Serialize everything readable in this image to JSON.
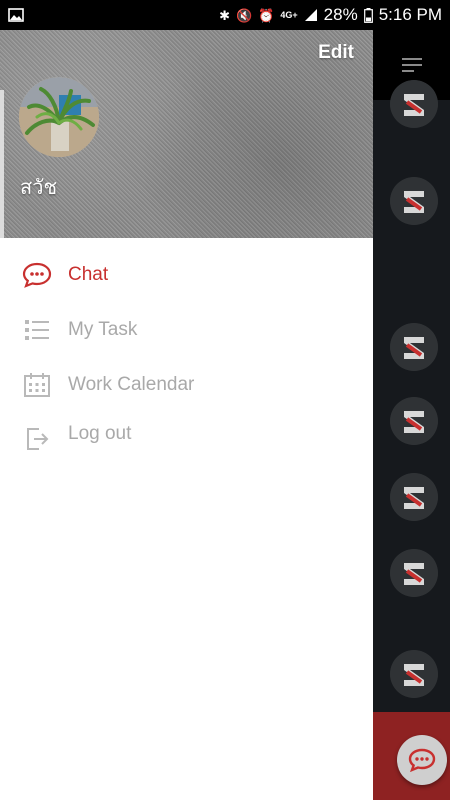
{
  "status_bar": {
    "signal_label": "4G+",
    "battery": "28%",
    "time": "5:16 PM"
  },
  "drawer": {
    "edit_label": "Edit",
    "user_name": "สวัช",
    "menu": [
      {
        "label": "Chat",
        "icon": "chat-bubble-icon",
        "active": true
      },
      {
        "label": "My Task",
        "icon": "task-list-icon",
        "active": false
      },
      {
        "label": "Work Calendar",
        "icon": "calendar-icon",
        "active": false
      },
      {
        "label": "Log out",
        "icon": "logout-icon",
        "active": false
      }
    ]
  },
  "colors": {
    "accent": "#c8302f",
    "inactive_text": "#a9a9a9",
    "background_panel": "#16191d",
    "fab_red": "#8e2222"
  }
}
